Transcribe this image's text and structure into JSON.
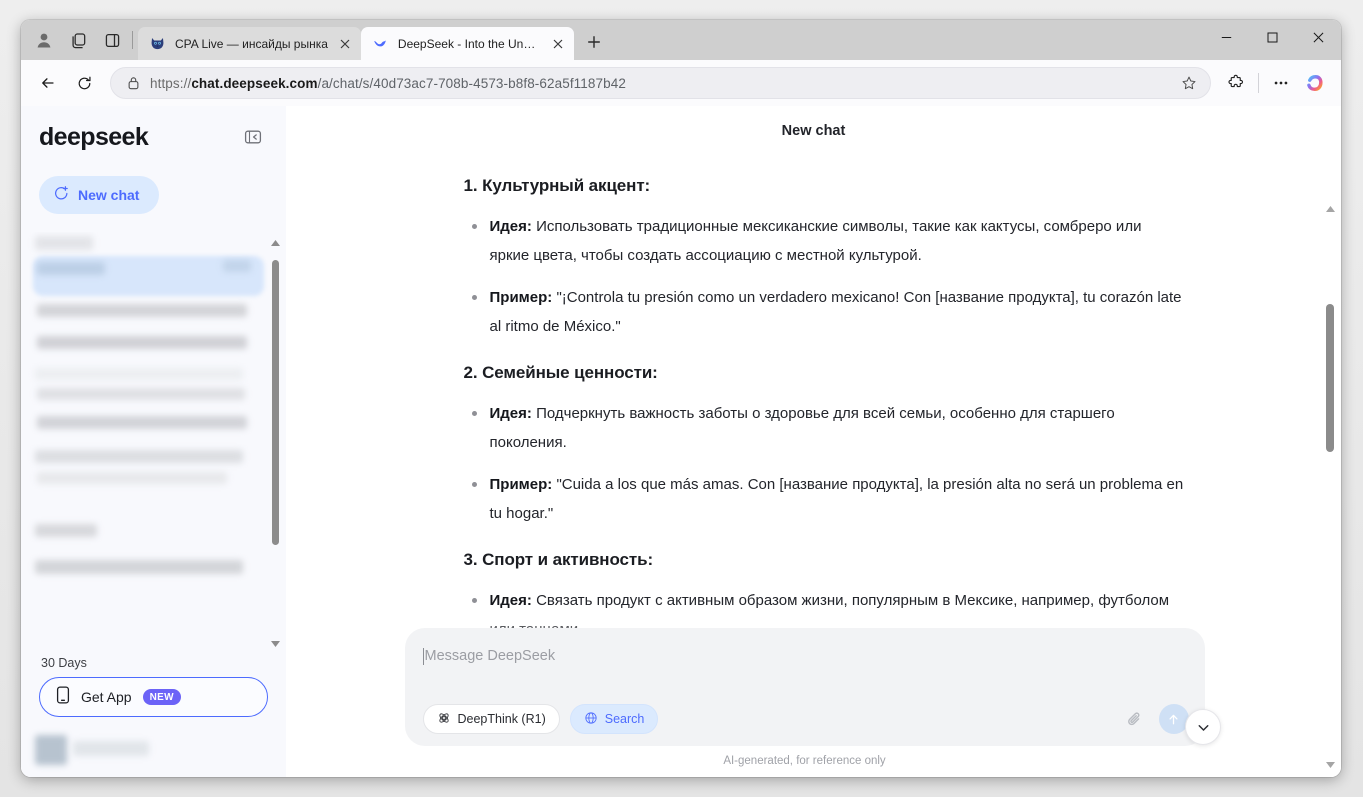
{
  "browser": {
    "toolbar_icons": {
      "profile": "profile-icon",
      "collections": "collections-icon",
      "split_screen": "split-screen-icon",
      "new_tab": "new-tab-icon",
      "minimize": "minimize-icon",
      "maximize": "maximize-icon",
      "close": "close-icon",
      "back": "back-arrow-icon",
      "reload": "reload-icon",
      "lock": "lock-icon",
      "favorite": "star-icon",
      "extensions": "extensions-puzzle-icon",
      "more": "more-ellipsis-icon",
      "copilot": "copilot-icon"
    },
    "tabs": [
      {
        "title": "CPA Live — инсайды рынка",
        "favicon": "cat-favicon",
        "active": false
      },
      {
        "title": "DeepSeek - Into the Unknown",
        "favicon": "deepseek-whale-favicon",
        "active": true
      }
    ],
    "address": {
      "scheme": "https://",
      "domain": "chat.deepseek.com",
      "path": "/a/chat/s/40d73ac7-708b-4573-b8f8-62a5f1187b42"
    }
  },
  "sidebar": {
    "brand": "deepseek",
    "collapse_icon": "collapse-sidebar-icon",
    "new_chat": {
      "label": "New chat",
      "icon": "new-chat-icon"
    },
    "section_label": "30 Days",
    "get_app": {
      "label": "Get App",
      "badge": "NEW",
      "icon": "mobile-phone-icon"
    },
    "colors": {
      "accent": "#4d6bfe",
      "selected_item": "#d7e6fb",
      "badge": "#6c63f7",
      "background": "#f8f9fd"
    }
  },
  "main": {
    "title": "New chat",
    "scroll_down_icon": "chevron-down-icon",
    "sections": [
      {
        "heading": "1. Культурный акцент:",
        "points": [
          {
            "label": "Идея:",
            "text": "Использовать традиционные мексиканские символы, такие как кактусы, сомбреро или яркие цвета, чтобы создать ассоциацию с местной культурой."
          },
          {
            "label": "Пример:",
            "text": "\"¡Controla tu presión como un verdadero mexicano! Con [название продукта], tu corazón late al ritmo de México.\""
          }
        ]
      },
      {
        "heading": "2. Семейные ценности:",
        "points": [
          {
            "label": "Идея:",
            "text": "Подчеркнуть важность заботы о здоровье для всей семьи, особенно для старшего поколения."
          },
          {
            "label": "Пример:",
            "text": "\"Cuida a los que más amas. Con [название продукта], la presión alta no será un problema en tu hogar.\""
          }
        ]
      },
      {
        "heading": "3. Спорт и активность:",
        "points": [
          {
            "label": "Идея:",
            "text": "Связать продукт с активным образом жизни, популярным в Мексике, например, футболом или танцами."
          }
        ]
      }
    ]
  },
  "composer": {
    "placeholder": "Message DeepSeek",
    "deepthink": {
      "label": "DeepThink (R1)",
      "icon": "atom-icon",
      "active": false
    },
    "search": {
      "label": "Search",
      "icon": "globe-icon",
      "active": true
    },
    "attach_icon": "paperclip-icon",
    "send_icon": "send-arrow-up-icon",
    "disclaimer": "AI-generated, for reference only"
  }
}
